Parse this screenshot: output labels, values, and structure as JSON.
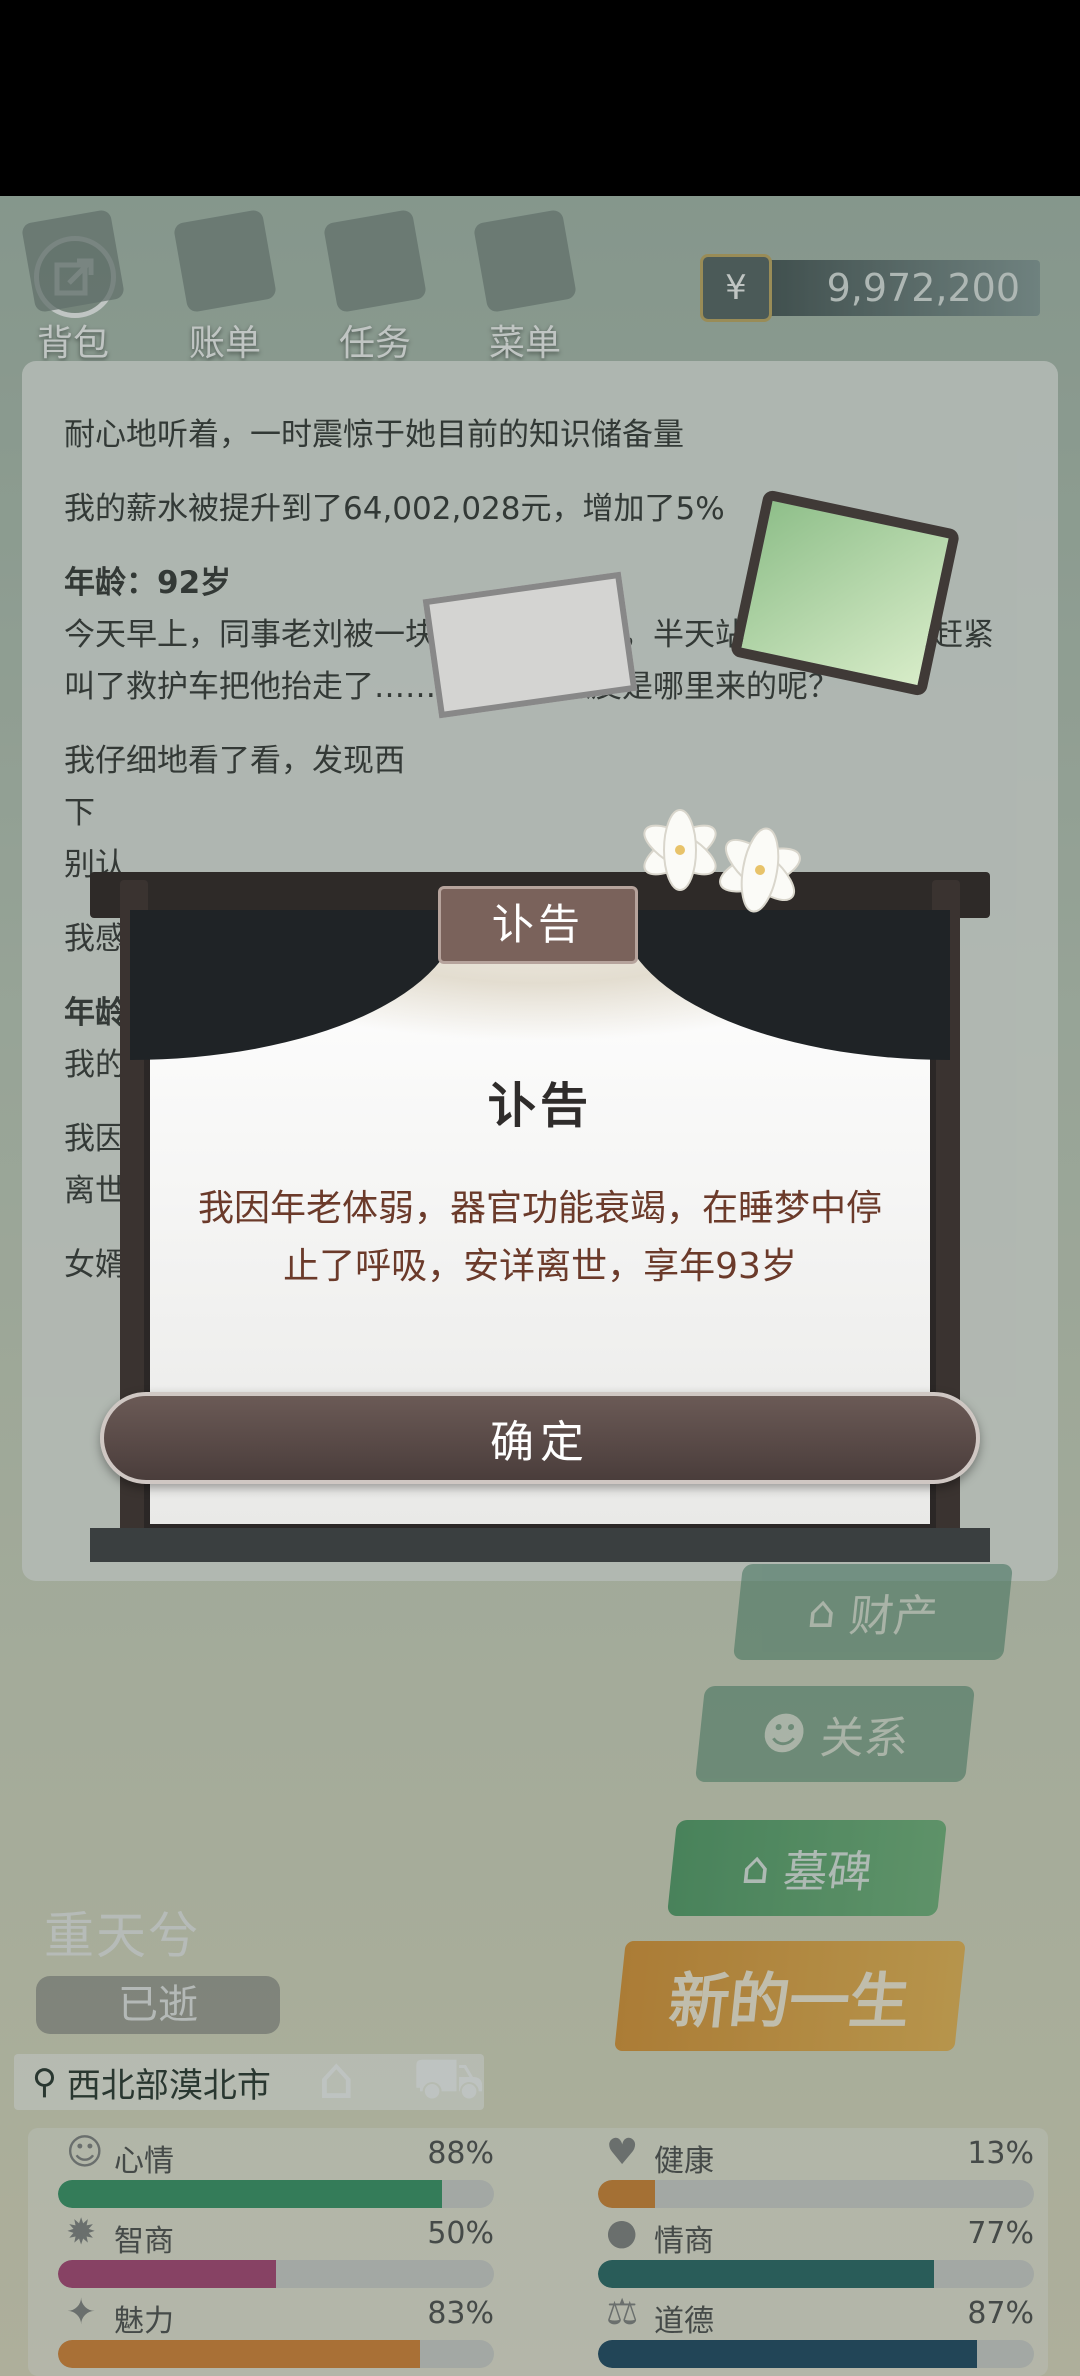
{
  "nav": {
    "items": [
      {
        "label": "背包",
        "icon": "backpack-icon"
      },
      {
        "label": "账单",
        "icon": "bill-icon"
      },
      {
        "label": "任务",
        "icon": "task-icon"
      },
      {
        "label": "菜单",
        "icon": "menu-icon"
      }
    ],
    "money": "9,972,200",
    "currency_symbol": "¥"
  },
  "diary": {
    "cut_line": "耐心地听着，一时震惊于她目前的知识储备量",
    "salary": "我的薪水被提升到了64,002,028元，增加了5%",
    "age_92": "年龄：92岁",
    "entry_92": "今天早上，同事老刘被一块西瓜皮绊倒了，半天站不起来，我们赶紧叫了救护车把他抬走了……可是，西瓜皮是哪里来的呢？",
    "entry_look": "我仔细地看了看，发现西",
    "entry_look2": "下",
    "entry_look3": "别认",
    "entry_feel": "我感",
    "age_93": "年龄",
    "entry_93a": "我的",
    "entry_93b": "我因",
    "entry_93b2": "离世",
    "entry_93c": "女婿"
  },
  "side_buttons": {
    "property": "财产",
    "relations": "关系",
    "tomb": "墓碑",
    "new_life": "新的一生"
  },
  "character": {
    "name": "重天兮",
    "status": "已逝",
    "location": "西北部漠北市"
  },
  "stats": [
    {
      "label": "心情",
      "value": "88%",
      "fraction": 0.88,
      "color": "#3e9a6c",
      "icon": "smile-icon"
    },
    {
      "label": "健康",
      "value": "13%",
      "fraction": 0.13,
      "color": "#d98a3a",
      "icon": "heart-icon"
    },
    {
      "label": "智商",
      "value": "50%",
      "fraction": 0.5,
      "color": "#b04a7c",
      "icon": "bulb-icon"
    },
    {
      "label": "情商",
      "value": "77%",
      "fraction": 0.77,
      "color": "#2f6e6c",
      "icon": "apple-icon"
    },
    {
      "label": "魅力",
      "value": "83%",
      "fraction": 0.83,
      "color": "#e08a3c",
      "icon": "sparkle-icon"
    },
    {
      "label": "道德",
      "value": "87%",
      "fraction": 0.87,
      "color": "#244e6a",
      "icon": "scale-icon"
    }
  ],
  "modal": {
    "banner": "讣告",
    "title": "讣告",
    "message": "我因年老体弱，器官功能衰竭，在睡梦中停止了呼吸，安详离世，享年93岁",
    "confirm": "确定"
  }
}
